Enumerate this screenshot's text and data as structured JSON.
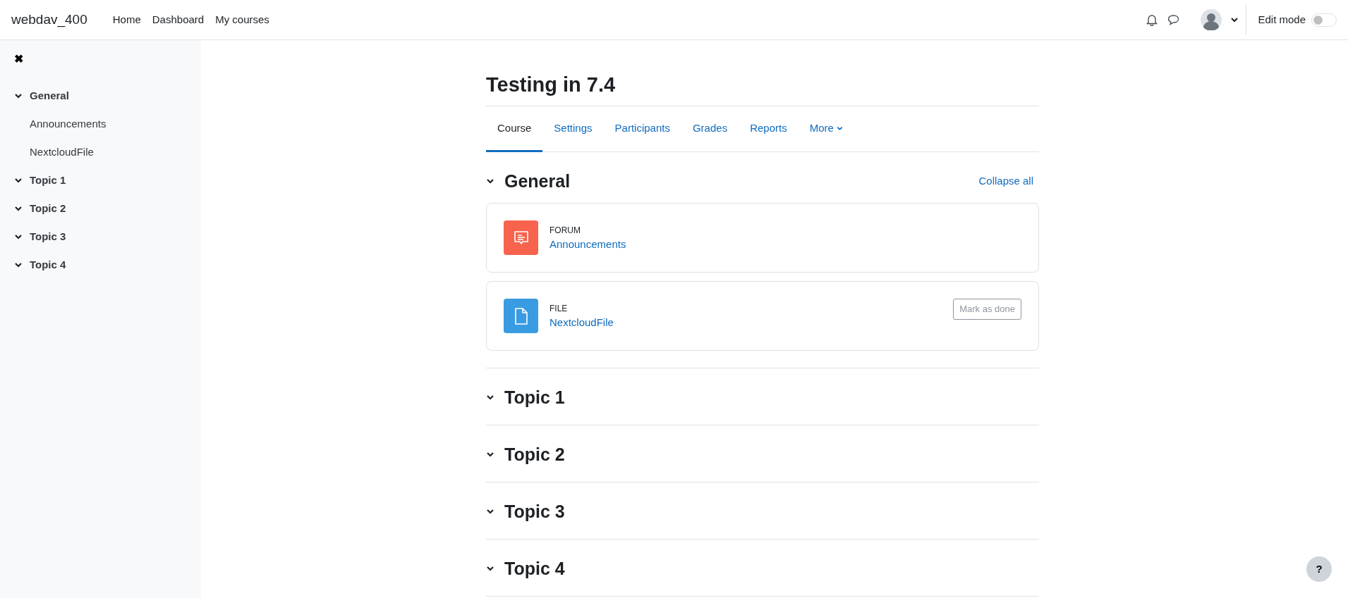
{
  "navbar": {
    "site_name": "webdav_400",
    "links": [
      "Home",
      "Dashboard",
      "My courses"
    ],
    "edit_mode": {
      "label": "Edit mode",
      "on": false
    }
  },
  "sidebar": {
    "close_symbol": "✖",
    "items": [
      {
        "label": "General",
        "expanded": true,
        "children": [
          {
            "label": "Announcements"
          },
          {
            "label": "NextcloudFile"
          }
        ]
      },
      {
        "label": "Topic 1",
        "expanded": true
      },
      {
        "label": "Topic 2",
        "expanded": true
      },
      {
        "label": "Topic 3",
        "expanded": true
      },
      {
        "label": "Topic 4",
        "expanded": true
      }
    ]
  },
  "course": {
    "title": "Testing in 7.4",
    "tabs": [
      {
        "label": "Course",
        "selected": true,
        "kind": "tab"
      },
      {
        "label": "Settings",
        "selected": false,
        "kind": "tab"
      },
      {
        "label": "Participants",
        "selected": false,
        "kind": "tab"
      },
      {
        "label": "Grades",
        "selected": false,
        "kind": "tab"
      },
      {
        "label": "Reports",
        "selected": false,
        "kind": "tab"
      },
      {
        "label": "More",
        "selected": false,
        "kind": "dropdown"
      }
    ],
    "collapse_all": "Collapse all",
    "sections": [
      {
        "title": "General",
        "expanded": true,
        "activities": [
          {
            "kind": "forum",
            "type": "FORUM",
            "name": "Announcements"
          },
          {
            "kind": "file",
            "type": "FILE",
            "name": "NextcloudFile",
            "completion_button": "Mark as done"
          }
        ]
      },
      {
        "title": "Topic 1",
        "expanded": true
      },
      {
        "title": "Topic 2",
        "expanded": true
      },
      {
        "title": "Topic 3",
        "expanded": true
      },
      {
        "title": "Topic 4",
        "expanded": true
      }
    ]
  },
  "help_button": "?"
}
